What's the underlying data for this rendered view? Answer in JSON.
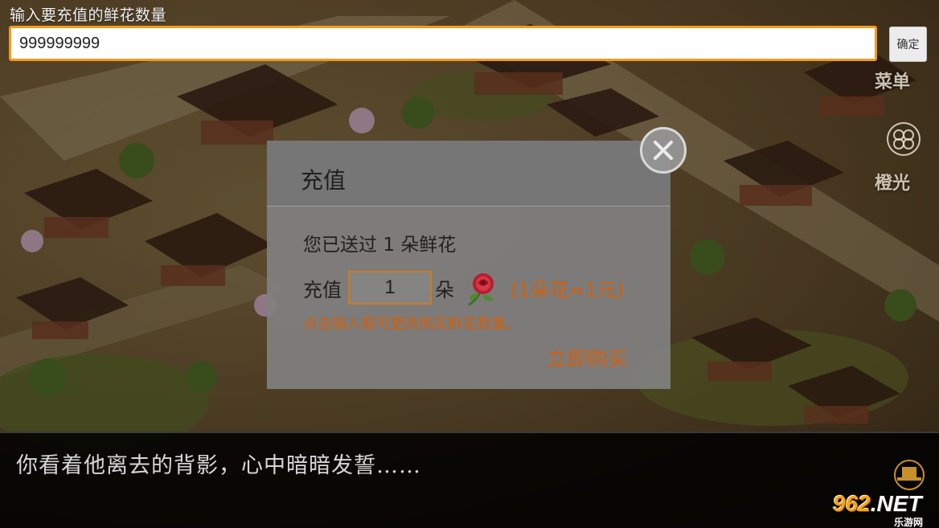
{
  "input_bar": {
    "title": "输入要充值的鲜花数量",
    "value": "999999999",
    "confirm_label": "确定"
  },
  "side_menu": {
    "menu_label": "菜单",
    "light_label": "橙光"
  },
  "modal": {
    "title": "充值",
    "sent_prefix": "您已送过",
    "sent_count": "1",
    "sent_suffix": "朵鲜花",
    "recharge_label": "充值",
    "quantity": "1",
    "unit": "朵",
    "price_note": "(1朵花=1元)",
    "hint": "点击输入框可更改购买鲜花数量。",
    "buy_label": "立即购买"
  },
  "dialog": {
    "text": "你看着他离去的背影，心中暗暗发誓……"
  },
  "watermark": {
    "main": "962",
    "net": ".NET",
    "sub": "乐游网"
  },
  "colors": {
    "accent": "#f39a1b",
    "price_text": "#d06010",
    "modal_bg": "#808080"
  }
}
